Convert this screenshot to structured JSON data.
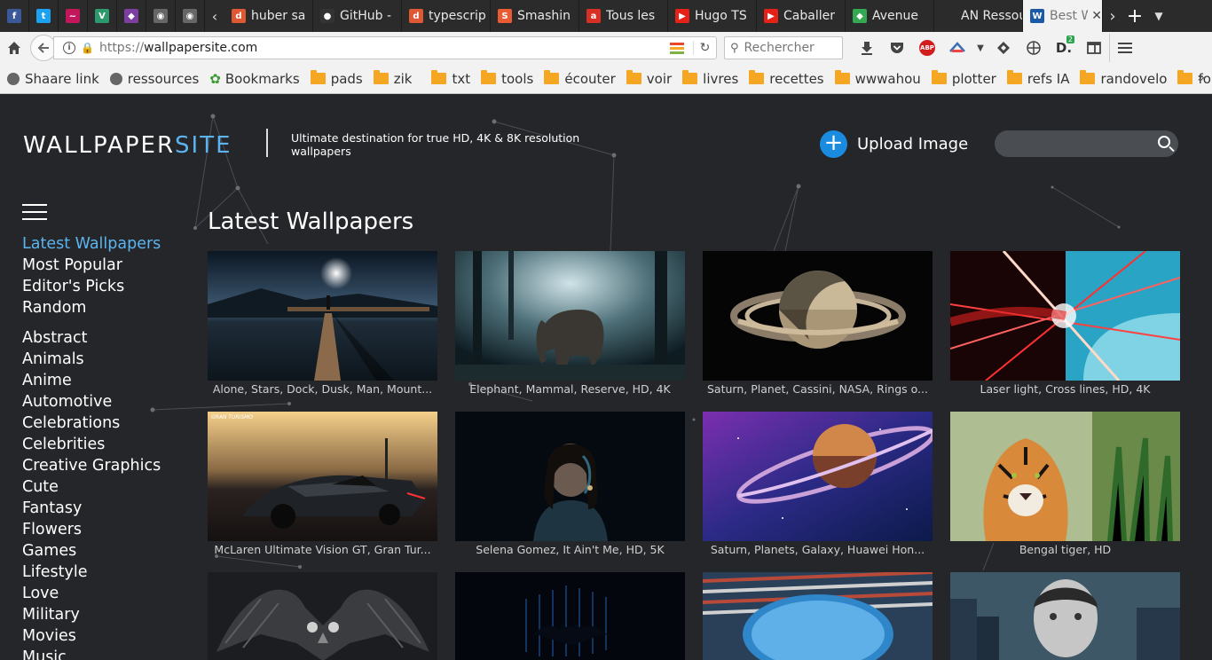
{
  "browser": {
    "pinned_tabs": [
      {
        "icon": "facebook-icon",
        "glyph": "f",
        "color": "#3b5998"
      },
      {
        "icon": "twitter-icon",
        "glyph": "t",
        "color": "#1da1f2"
      },
      {
        "icon": "lips-icon",
        "glyph": "~",
        "color": "#c2185b"
      },
      {
        "icon": "vue-icon",
        "glyph": "V",
        "color": "#2c9a6c"
      },
      {
        "icon": "gem-icon",
        "glyph": "◆",
        "color": "#7b3fa0"
      },
      {
        "icon": "globe-icon",
        "glyph": "◉",
        "color": "#666"
      },
      {
        "icon": "globe-icon",
        "glyph": "◉",
        "color": "#666"
      }
    ],
    "tabs": [
      {
        "title": "huber sa",
        "icon": "duckduckgo-icon",
        "glyph": "d",
        "color": "#de5833"
      },
      {
        "title": "GitHub -",
        "icon": "github-icon",
        "glyph": "●",
        "color": "#333"
      },
      {
        "title": "typescrip",
        "icon": "duckduckgo-icon",
        "glyph": "d",
        "color": "#de5833"
      },
      {
        "title": "Smashin",
        "icon": "smashing-icon",
        "glyph": "S",
        "color": "#e85c33"
      },
      {
        "title": "Tous les",
        "icon": "marmiton-icon",
        "glyph": "a",
        "color": "#d93025"
      },
      {
        "title": "Hugo TS",
        "icon": "youtube-icon",
        "glyph": "▶",
        "color": "#e62117"
      },
      {
        "title": "Caballer",
        "icon": "youtube-icon",
        "glyph": "▶",
        "color": "#e62117"
      },
      {
        "title": "Avenue",
        "icon": "maps-icon",
        "glyph": "◆",
        "color": "#34a853"
      },
      {
        "title": "AN Ressour",
        "icon": "an-icon",
        "glyph": "",
        "color": "#2b2b2b"
      }
    ],
    "active_tab": {
      "title": "Best W",
      "icon": "wallpapersite-icon",
      "glyph": "W",
      "color": "#1a5aa6"
    },
    "url_prefix": "https://",
    "url_domain": "wallpapersite.com",
    "search_placeholder": "Rechercher",
    "badge_count": "2",
    "bookmarks": [
      {
        "label": "Shaare link",
        "kind": "globe"
      },
      {
        "label": "ressources",
        "kind": "globe"
      },
      {
        "label": "Bookmarks",
        "kind": "star"
      },
      {
        "label": "pads",
        "kind": "folder"
      },
      {
        "label": "zik",
        "kind": "folder"
      },
      {
        "label": "txt",
        "kind": "folder",
        "sep_before": true
      },
      {
        "label": "tools",
        "kind": "folder"
      },
      {
        "label": "écouter",
        "kind": "folder"
      },
      {
        "label": "voir",
        "kind": "folder"
      },
      {
        "label": "livres",
        "kind": "folder"
      },
      {
        "label": "recettes",
        "kind": "folder"
      },
      {
        "label": "wwwahou",
        "kind": "folder"
      },
      {
        "label": "plotter",
        "kind": "folder"
      },
      {
        "label": "refs IA",
        "kind": "folder"
      },
      {
        "label": "randovelo",
        "kind": "folder"
      },
      {
        "label": "fonderies",
        "kind": "folder"
      }
    ]
  },
  "site": {
    "logo_main": "WALLPAPER",
    "logo_accent": "SITE",
    "tagline": "Ultimate destination for true HD, 4K & 8K resolution wallpapers",
    "upload_label": "Upload Image",
    "section_title": "Latest Wallpapers",
    "nav_primary": [
      "Latest Wallpapers",
      "Most Popular",
      "Editor's Picks",
      "Random"
    ],
    "nav_categories": [
      "Abstract",
      "Animals",
      "Anime",
      "Automotive",
      "Celebrations",
      "Celebrities",
      "Creative Graphics",
      "Cute",
      "Fantasy",
      "Flowers",
      "Games",
      "Lifestyle",
      "Love",
      "Military",
      "Movies",
      "Music"
    ],
    "accent_color": "#5bb4ef",
    "upload_color": "#1a8ce0",
    "wallpapers": [
      {
        "caption": "Alone, Stars, Dock, Dusk, Man, Mount...",
        "art": "dock"
      },
      {
        "caption": "Elephant, Mammal, Reserve, HD, 4K",
        "art": "elephant"
      },
      {
        "caption": "Saturn, Planet, Cassini, NASA, Rings o...",
        "art": "saturn"
      },
      {
        "caption": "Laser light, Cross lines, HD, 4K",
        "art": "laser"
      },
      {
        "caption": "McLaren Ultimate Vision GT, Gran Tur...",
        "art": "car"
      },
      {
        "caption": "Selena Gomez, It Ain't Me, HD, 5K",
        "art": "portrait"
      },
      {
        "caption": "Saturn, Planets, Galaxy, Huawei Hon...",
        "art": "galaxy"
      },
      {
        "caption": "Bengal tiger, HD",
        "art": "tiger"
      },
      {
        "caption": "",
        "art": "owl"
      },
      {
        "caption": "",
        "art": "batman"
      },
      {
        "caption": "",
        "art": "architecture"
      },
      {
        "caption": "",
        "art": "gotham"
      }
    ]
  }
}
